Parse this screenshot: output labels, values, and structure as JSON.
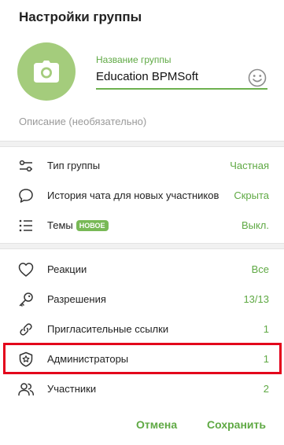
{
  "dialog": {
    "title": "Настройки группы",
    "photo_icon": "camera-icon",
    "name_label": "Название группы",
    "name_value": "Education BPMSoft",
    "emoji_icon": "smile-icon",
    "description_placeholder": "Описание (необязательно)"
  },
  "settings_section": [
    {
      "icon": "sliders-icon",
      "label": "Тип группы",
      "value": "Частная"
    },
    {
      "icon": "chat-bubble-icon",
      "label": "История чата для новых участников",
      "value": "Скрыта"
    },
    {
      "icon": "list-icon",
      "label": "Темы",
      "badge": "НОВОЕ",
      "value": "Выкл."
    }
  ],
  "manage_section": [
    {
      "icon": "heart-icon",
      "label": "Реакции",
      "value": "Все"
    },
    {
      "icon": "key-icon",
      "label": "Разрешения",
      "value": "13/13"
    },
    {
      "icon": "link-icon",
      "label": "Пригласительные ссылки",
      "value": "1"
    },
    {
      "icon": "shield-star-icon",
      "label": "Администраторы",
      "value": "1",
      "highlighted": true
    },
    {
      "icon": "people-icon",
      "label": "Участники",
      "value": "2"
    }
  ],
  "footer": {
    "cancel_label": "Отмена",
    "save_label": "Сохранить"
  },
  "colors": {
    "accent": "#5fa944",
    "photo_bg": "#a4cc7c",
    "badge_bg": "#78b956",
    "highlight": "#e3001b"
  }
}
